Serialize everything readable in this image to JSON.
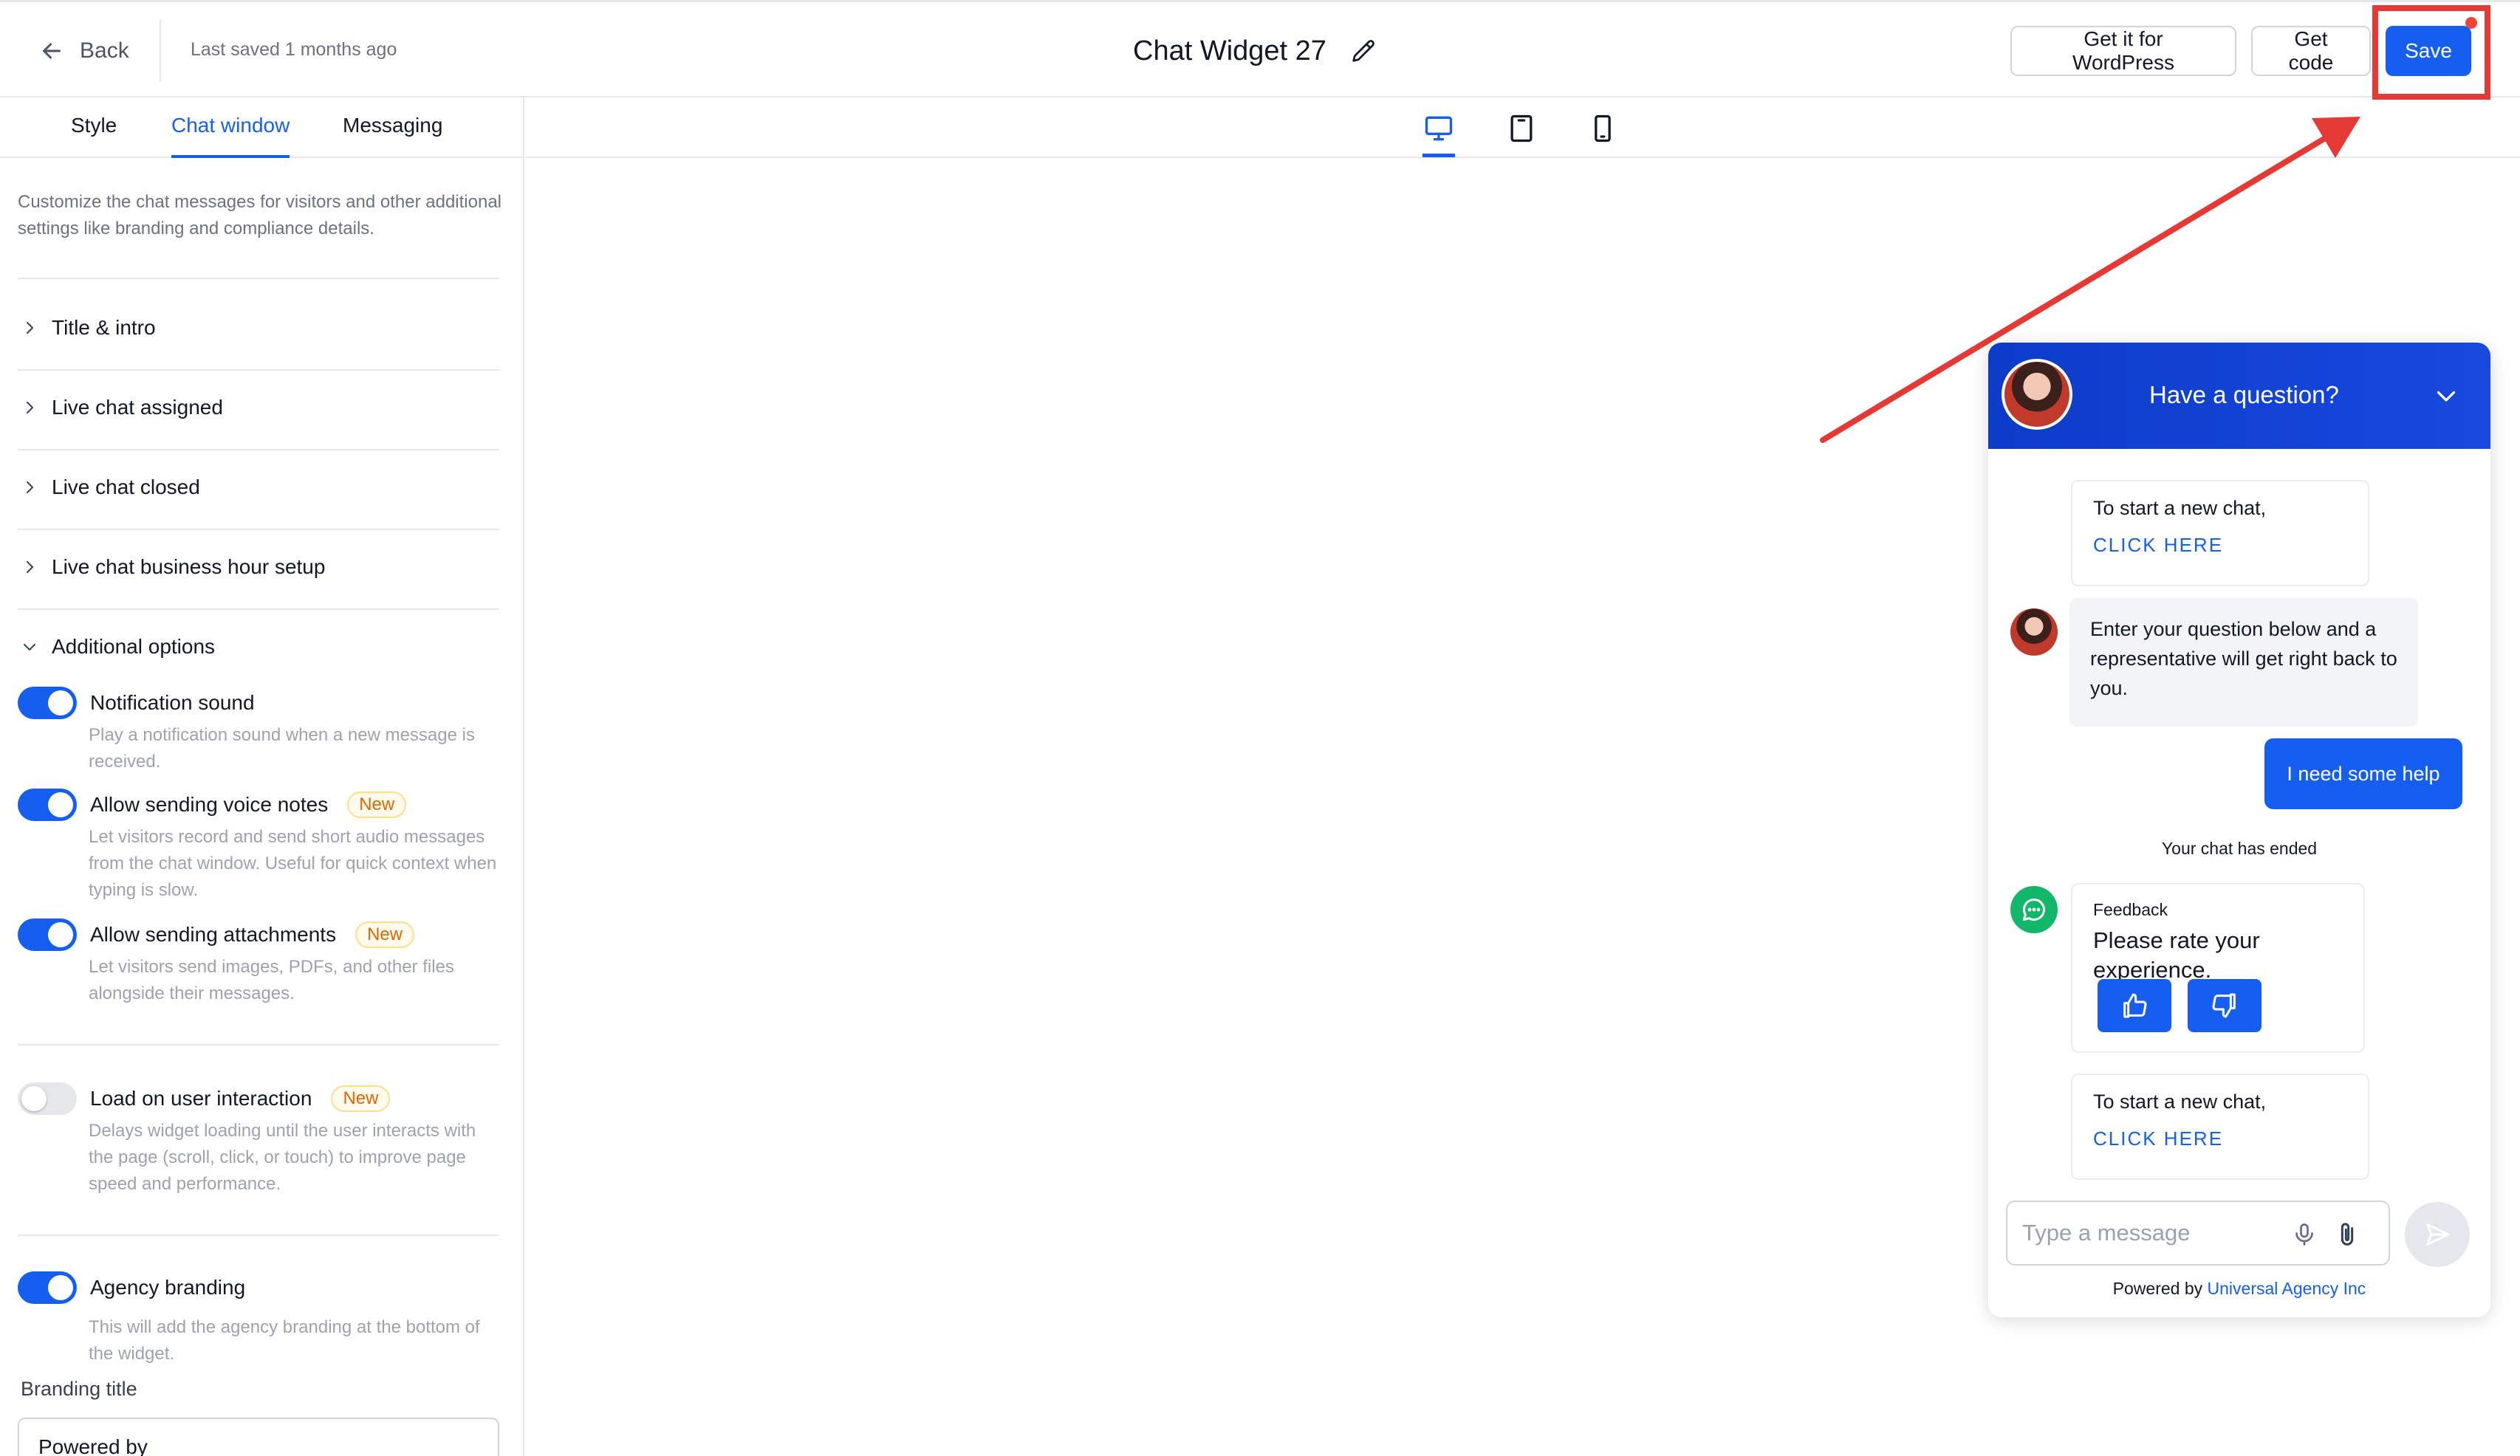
{
  "header": {
    "back_label": "Back",
    "last_saved": "Last saved 1 months ago",
    "title": "Chat Widget 27",
    "wordpress_label": "Get it for WordPress",
    "get_code_label": "Get code",
    "save_label": "Save"
  },
  "tabs": [
    {
      "label": "Style",
      "active": false
    },
    {
      "label": "Chat window",
      "active": true
    },
    {
      "label": "Messaging",
      "active": false
    }
  ],
  "panel": {
    "description": "Customize the chat messages for visitors and other additional settings like branding and compliance details.",
    "sections": [
      {
        "label": "Title & intro",
        "expanded": false
      },
      {
        "label": "Live chat assigned",
        "expanded": false
      },
      {
        "label": "Live chat closed",
        "expanded": false
      },
      {
        "label": "Live chat business hour setup",
        "expanded": false
      },
      {
        "label": "Additional options",
        "expanded": true
      }
    ],
    "options": [
      {
        "label": "Notification sound",
        "enabled": true,
        "badge": "",
        "description": "Play a notification sound when a new message is received."
      },
      {
        "label": "Allow sending voice notes",
        "enabled": true,
        "badge": "New",
        "description": "Let visitors record and send short audio messages from the chat window. Useful for quick context when typing is slow."
      },
      {
        "label": "Allow sending attachments",
        "enabled": true,
        "badge": "New",
        "description": "Let visitors send images, PDFs, and other files alongside their messages."
      },
      {
        "label": "Load on user interaction",
        "enabled": false,
        "badge": "New",
        "description": "Delays widget loading until the user interacts with the page (scroll, click, or touch) to improve page speed and performance."
      },
      {
        "label": "Agency branding",
        "enabled": true,
        "badge": "",
        "description": "This will add the agency branding at the bottom of the widget."
      }
    ],
    "branding_title_label": "Branding title",
    "branding_title_value": "Powered by"
  },
  "preview": {
    "devices": [
      "desktop-icon",
      "tablet-icon",
      "mobile-icon"
    ],
    "active_device": "desktop"
  },
  "widget": {
    "header_title": "Have a question?",
    "new_chat_text": "To start a new chat,",
    "click_here": "CLICK HERE",
    "agent_message": "Enter your question below and a representative will get right back to you.",
    "user_message": "I need some help",
    "chat_ended": "Your chat has ended",
    "feedback_label": "Feedback",
    "feedback_question": "Please rate your experience.",
    "input_placeholder": "Type a message",
    "powered_by_label": "Powered by",
    "agency_name": "Universal Agency Inc"
  },
  "colors": {
    "primary": "#155eef",
    "widget_header": "#0d3cc9",
    "annotation": "#e53935",
    "feedback_green": "#12b76a"
  }
}
